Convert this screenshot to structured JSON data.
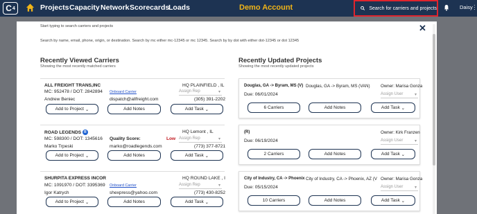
{
  "nav": {
    "logo": "C",
    "logo_sup": "4",
    "links": [
      "Projects",
      "Capacity",
      "Network",
      "Scorecards",
      "Loads"
    ],
    "demo": "Demo Account",
    "search_placeholder": "Search for carriers and projects",
    "user": "Daisy"
  },
  "modal": {
    "hint1": "Start typing to search carriers and projects",
    "hint2": "Search by name, email, phone, origin, or destination. Search by mc either mc-12345 or mc 12345. Search by by dot with either dot-12345 or dot 12345",
    "carriers_title": "Recently Viewed Carriers",
    "carriers_sub": "Showing the most recently matched carriers",
    "projects_title": "Recently Updated Projects",
    "projects_sub": "Showing the most recently updated projects"
  },
  "carriers": [
    {
      "name": "ALL FREIGHT TRANS,INC",
      "hq": "HQ PLAINFIELD , IL",
      "mcdot": "MC: 952478 / DOT: 2842894",
      "tag": "Onboard Carrier",
      "contact": "Andrew Beniec",
      "email": "dispatch@allfreight.com",
      "phone": "(305) 391-2202",
      "rep": "Assign Rep",
      "btn_project": "Add to Project",
      "btn_notes": "Add Notes",
      "btn_task": "Add Task"
    },
    {
      "name": "ROAD LEGENDS",
      "badge": "R",
      "hq": "HQ Lemont , IL",
      "mcdot": "MC: 598300 / DOT: 1345616",
      "quality_label": "Quality Score:",
      "quality": "Low",
      "contact": "Marko Trpeski",
      "email": "marko@roadlegends.com",
      "phone": "(773) 377-8721",
      "rep": "Assign Rep",
      "btn_project": "Add to Project",
      "btn_notes": "Add Notes",
      "btn_task": "Add Task"
    },
    {
      "name": "SHURPITA EXPRESS INCOR",
      "hq": "HQ ROUND LAKE , I",
      "mcdot": "MC: 1091970 / DOT: 3395369",
      "tag": "Onboard Carrier",
      "contact": "Igor Katrych",
      "email": "shexpress@yahoo.com",
      "phone": "(773) 430-8252",
      "rep": "Assign Rep",
      "btn_project": "Add to Project",
      "btn_notes": "Add Notes",
      "btn_task": "Add Task"
    }
  ],
  "projects": [
    {
      "name": "Douglas, GA -> Byram, MS (V)",
      "lane": "Douglas, GA -> Byram, MS (VAN)",
      "owner": "Owner: Marisa Gonza",
      "due": "Due: 06/01/2024",
      "assign": "Assign User",
      "btn_carriers": "6 Carriers",
      "btn_notes": "Add Notes",
      "btn_task": "Add Task"
    },
    {
      "name": "(R)",
      "lane": "",
      "owner": "Owner: Kirk Franzen",
      "due": "Due: 06/19/2024",
      "assign": "Assign User",
      "btn_carriers": "2 Carriers",
      "btn_notes": "Add Notes",
      "btn_task": "Add Task"
    },
    {
      "name": "City of Industry, CA -> Phoenix",
      "lane": "City of Industry, CA -> Phoenix, AZ (V",
      "owner": "Owner: Marisa Gonza",
      "due": "Due: 05/15/2024",
      "assign": "Assign User",
      "btn_carriers": "10 Carriers",
      "btn_notes": "Add Notes",
      "btn_task": "Add Task"
    }
  ]
}
